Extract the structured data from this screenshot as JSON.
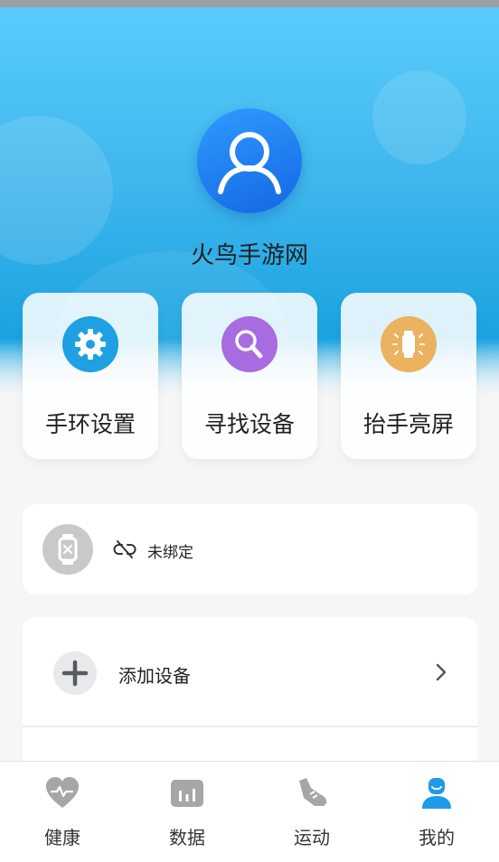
{
  "profile": {
    "username": "火鸟手游网"
  },
  "quick_actions": [
    {
      "label": "手环设置",
      "icon": "gear-icon",
      "color": "#1ea0e2"
    },
    {
      "label": "寻找设备",
      "icon": "search-icon",
      "color": "#a96be0"
    },
    {
      "label": "抬手亮屏",
      "icon": "watch-light-icon",
      "color": "#ebb25f"
    }
  ],
  "device_status": {
    "text": "未绑定",
    "icon": "unlink-icon"
  },
  "device_list": {
    "add_label": "添加设备"
  },
  "bottom_nav": {
    "items": [
      {
        "label": "健康",
        "icon": "heart-pulse-icon"
      },
      {
        "label": "数据",
        "icon": "data-chart-icon"
      },
      {
        "label": "运动",
        "icon": "sneaker-icon"
      },
      {
        "label": "我的",
        "icon": "user-icon"
      }
    ],
    "active_index": 3,
    "active_color": "#1e9be8"
  }
}
